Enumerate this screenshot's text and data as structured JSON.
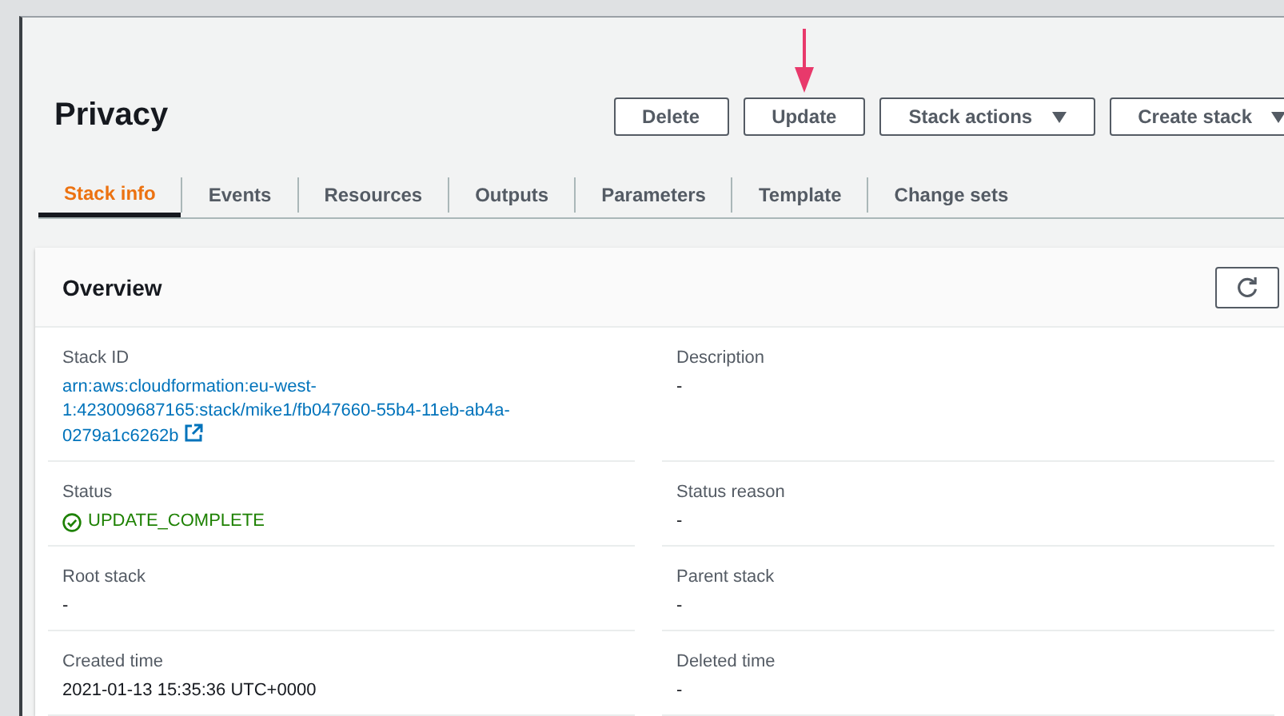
{
  "page": {
    "title": "Privacy"
  },
  "buttons": [
    {
      "label": "Delete",
      "dropdown": false
    },
    {
      "label": "Update",
      "dropdown": false
    },
    {
      "label": "Stack actions",
      "dropdown": true
    },
    {
      "label": "Create stack",
      "dropdown": true
    }
  ],
  "tabs": [
    {
      "label": "Stack info",
      "selected": true
    },
    {
      "label": "Events",
      "selected": false
    },
    {
      "label": "Resources",
      "selected": false
    },
    {
      "label": "Outputs",
      "selected": false
    },
    {
      "label": "Parameters",
      "selected": false
    },
    {
      "label": "Template",
      "selected": false
    },
    {
      "label": "Change sets",
      "selected": false
    }
  ],
  "overview": {
    "title": "Overview",
    "rows": [
      [
        {
          "label": "Stack ID",
          "value": "arn:aws:cloudformation:eu-west-1:423009687165:stack/mike1/fb047660-55b4-11eb-ab4a-0279a1c6262b",
          "kind": "link"
        },
        {
          "label": "Description",
          "value": "-",
          "kind": "text"
        }
      ],
      [
        {
          "label": "Status",
          "value": "UPDATE_COMPLETE",
          "kind": "success"
        },
        {
          "label": "Status reason",
          "value": "-",
          "kind": "text"
        }
      ],
      [
        {
          "label": "Root stack",
          "value": "-",
          "kind": "text"
        },
        {
          "label": "Parent stack",
          "value": "-",
          "kind": "text"
        }
      ],
      [
        {
          "label": "Created time",
          "value": "2021-01-13 15:35:36 UTC+0000",
          "kind": "text"
        },
        {
          "label": "Deleted time",
          "value": "-",
          "kind": "text"
        }
      ]
    ]
  }
}
